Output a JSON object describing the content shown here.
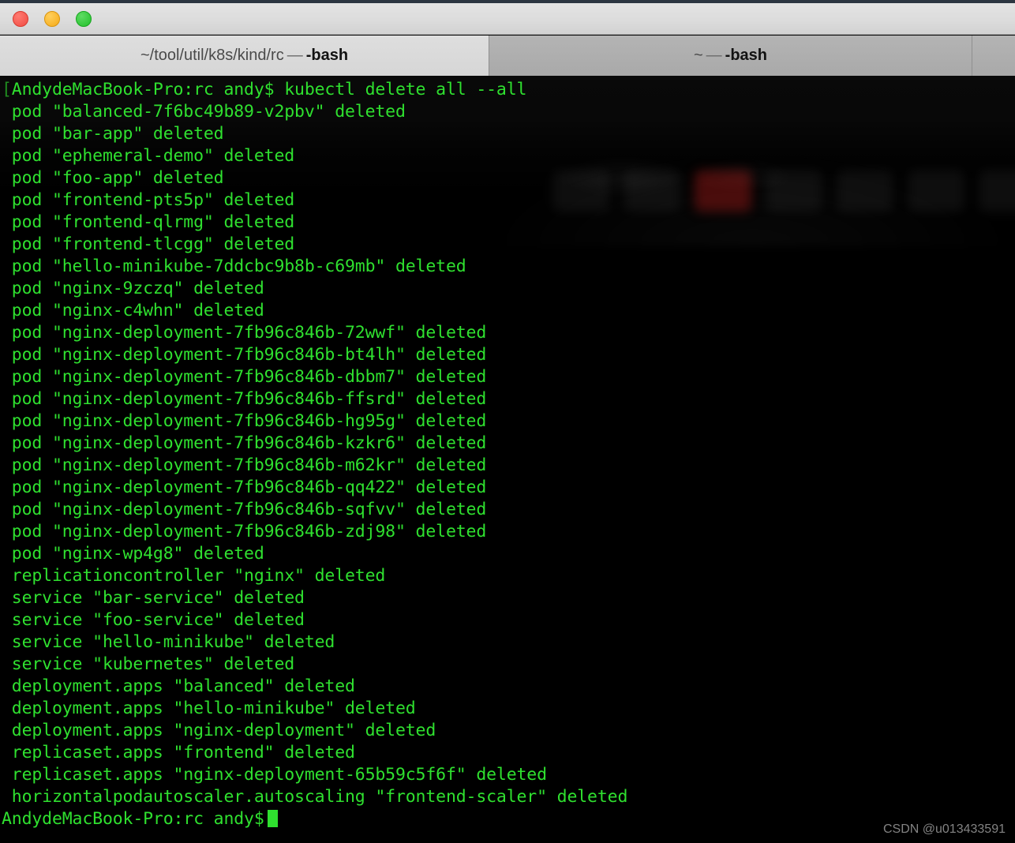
{
  "window": {
    "traffic_lights": [
      {
        "name": "close",
        "label": "Close",
        "color": "#f04b42"
      },
      {
        "name": "minimize",
        "label": "Minimize",
        "color": "#f5aa18"
      },
      {
        "name": "maximize",
        "label": "Maximize",
        "color": "#22bf2a"
      }
    ]
  },
  "tabs": [
    {
      "directory": "~/tool/util/k8s/kind/rc",
      "separator": "—",
      "process": "-bash",
      "full_label": "~/tool/util/k8s/kind/rc — -bash",
      "active": true
    },
    {
      "directory": "~",
      "separator": "—",
      "process": "-bash",
      "full_label": "~ — -bash",
      "active": false
    }
  ],
  "terminal": {
    "prompt_host": "AndydeMacBook-Pro",
    "prompt_dir": "rc",
    "prompt_user": "andy",
    "prompt_symbol": "$",
    "command": "kubectl delete all --all",
    "text_color": "#2fe02f",
    "background_color": "#000000",
    "lines": [
      "[AndydeMacBook-Pro:rc andy$ kubectl delete all --all",
      " pod \"balanced-7f6bc49b89-v2pbv\" deleted",
      " pod \"bar-app\" deleted",
      " pod \"ephemeral-demo\" deleted",
      " pod \"foo-app\" deleted",
      " pod \"frontend-pts5p\" deleted",
      " pod \"frontend-qlrmg\" deleted",
      " pod \"frontend-tlcgg\" deleted",
      " pod \"hello-minikube-7ddcbc9b8b-c69mb\" deleted",
      " pod \"nginx-9zczq\" deleted",
      " pod \"nginx-c4whn\" deleted",
      " pod \"nginx-deployment-7fb96c846b-72wwf\" deleted",
      " pod \"nginx-deployment-7fb96c846b-bt4lh\" deleted",
      " pod \"nginx-deployment-7fb96c846b-dbbm7\" deleted",
      " pod \"nginx-deployment-7fb96c846b-ffsrd\" deleted",
      " pod \"nginx-deployment-7fb96c846b-hg95g\" deleted",
      " pod \"nginx-deployment-7fb96c846b-kzkr6\" deleted",
      " pod \"nginx-deployment-7fb96c846b-m62kr\" deleted",
      " pod \"nginx-deployment-7fb96c846b-qq422\" deleted",
      " pod \"nginx-deployment-7fb96c846b-sqfvv\" deleted",
      " pod \"nginx-deployment-7fb96c846b-zdj98\" deleted",
      " pod \"nginx-wp4g8\" deleted",
      " replicationcontroller \"nginx\" deleted",
      " service \"bar-service\" deleted",
      " service \"foo-service\" deleted",
      " service \"hello-minikube\" deleted",
      " service \"kubernetes\" deleted",
      " deployment.apps \"balanced\" deleted",
      " deployment.apps \"hello-minikube\" deleted",
      " deployment.apps \"nginx-deployment\" deleted",
      " replicaset.apps \"frontend\" deleted",
      " replicaset.apps \"nginx-deployment-65b59c5f6f\" deleted",
      " horizontalpodautoscaler.autoscaling \"frontend-scaler\" deleted"
    ],
    "final_prompt": "AndydeMacBook-Pro:rc andy$"
  },
  "watermark": {
    "text": "CSDN @u013433591"
  }
}
